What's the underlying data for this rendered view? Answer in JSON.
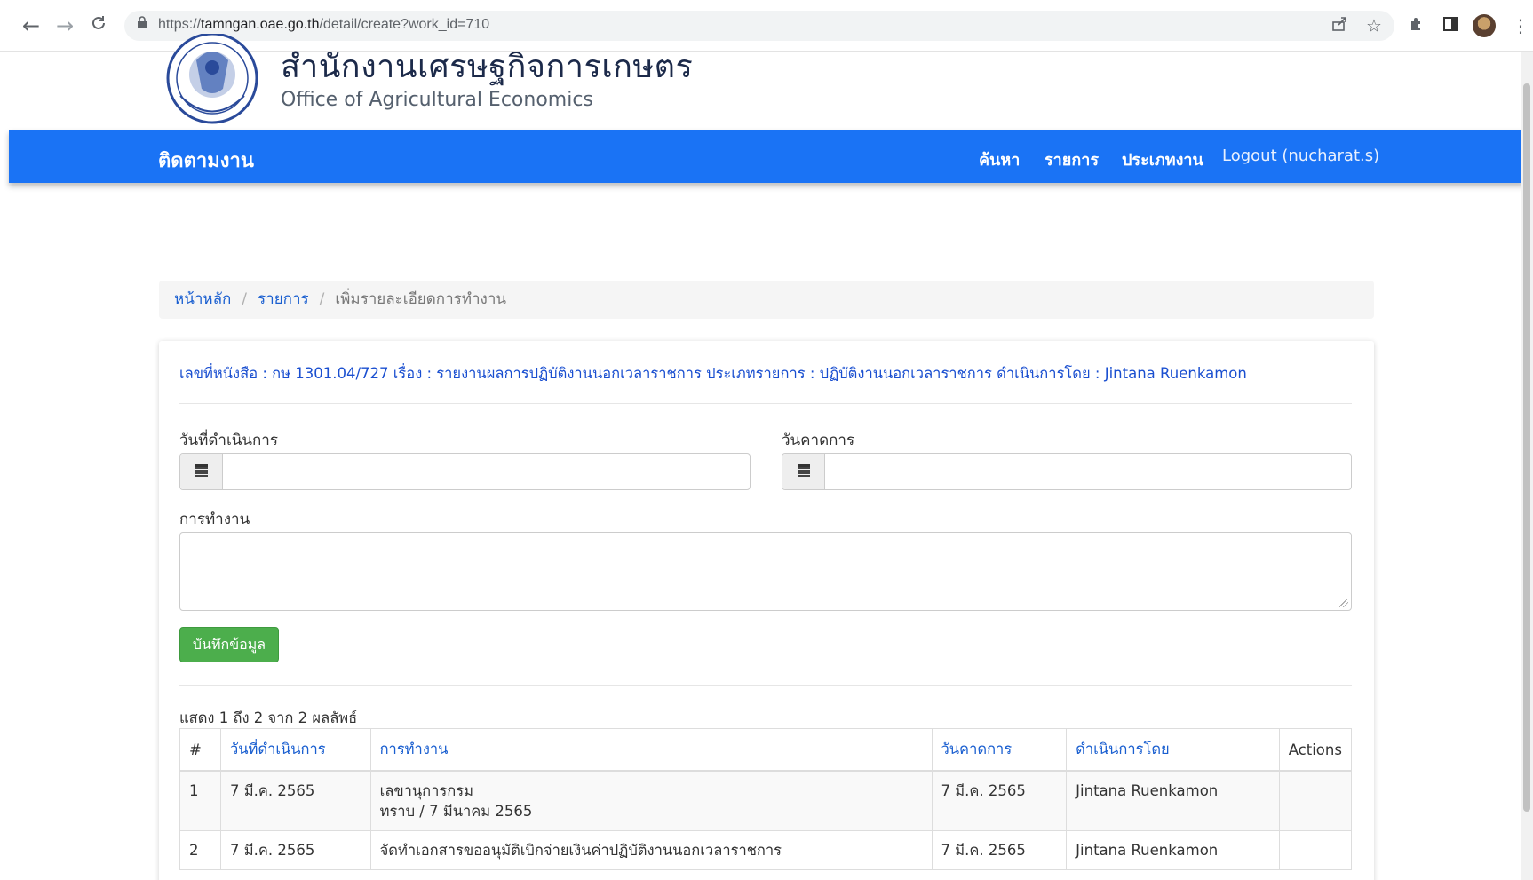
{
  "browser": {
    "url_prefix": "https://",
    "url_host": "tamngan.oae.go.th",
    "url_path": "/detail/create?work_id=710",
    "back_icon": "←",
    "forward_icon": "→",
    "reload_icon": "C"
  },
  "header": {
    "title_th": "สำนักงานเศรษฐกิจการเกษตร",
    "title_en": "Office of Agricultural Economics"
  },
  "navbar": {
    "brand": "ติดตามงาน",
    "items": [
      {
        "label": "ค้นหา"
      },
      {
        "label": "รายการ"
      },
      {
        "label": "ประเภทงาน"
      },
      {
        "label": "Logout (nucharat.s)"
      }
    ]
  },
  "breadcrumb": {
    "home": "หน้าหลัก",
    "list": "รายการ",
    "current": "เพิ่มรายละเอียดการทำงาน",
    "separator": "/"
  },
  "info_line": "เลขที่หนังสือ : กษ 1301.04/727 เรื่อง : รายงานผลการปฏิบัติงานนอกเวลาราชการ ประเภทรายการ : ปฏิบัติงานนอกเวลาราชการ ดำเนินการโดย : Jintana Ruenkamon",
  "form": {
    "date_label": "วันที่ดำเนินการ",
    "date_value": "",
    "due_label": "วันคาดการ",
    "due_value": "",
    "work_label": "การทำงาน",
    "work_value": "",
    "save_button": "บันทึกข้อมูล"
  },
  "table": {
    "summary": "แสดง 1 ถึง 2 จาก 2 ผลลัพธ์",
    "headers": [
      "#",
      "วันที่ดำเนินการ",
      "การทำงาน",
      "วันคาดการ",
      "ดำเนินการโดย",
      "Actions"
    ],
    "rows": [
      {
        "no": "1",
        "date": "7 มี.ค. 2565",
        "work_line1": "เลขานุการกรม",
        "work_line2": "ทราบ / 7 มีนาคม 2565",
        "due": "7 มี.ค. 2565",
        "by": "Jintana Ruenkamon",
        "actions": ""
      },
      {
        "no": "2",
        "date": "7 มี.ค. 2565",
        "work_line1": "จัดทำเอกสารขออนุมัติเบิกจ่ายเงินค่าปฏิบัติงานนอกเวลาราชการ",
        "work_line2": "",
        "due": "7 มี.ค. 2565",
        "by": "Jintana Ruenkamon",
        "actions": ""
      }
    ]
  }
}
